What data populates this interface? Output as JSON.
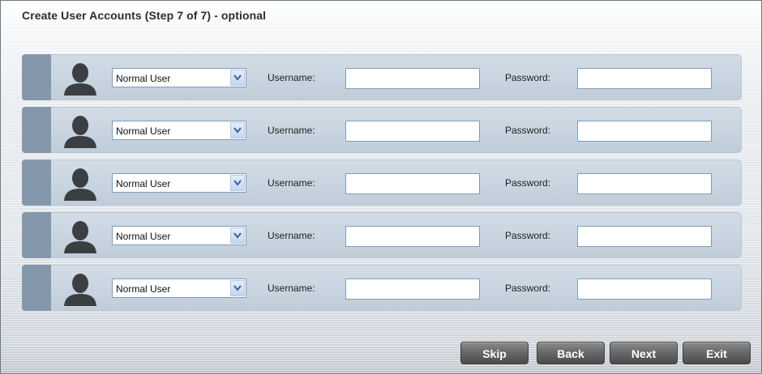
{
  "title": "Create User Accounts (Step 7 of 7) - optional",
  "rows": [
    {
      "role": "Normal User",
      "username_label": "Username:",
      "username": "",
      "password_label": "Password:",
      "password": ""
    },
    {
      "role": "Normal User",
      "username_label": "Username:",
      "username": "",
      "password_label": "Password:",
      "password": ""
    },
    {
      "role": "Normal User",
      "username_label": "Username:",
      "username": "",
      "password_label": "Password:",
      "password": ""
    },
    {
      "role": "Normal User",
      "username_label": "Username:",
      "username": "",
      "password_label": "Password:",
      "password": ""
    },
    {
      "role": "Normal User",
      "username_label": "Username:",
      "username": "",
      "password_label": "Password:",
      "password": ""
    }
  ],
  "buttons": {
    "skip": "Skip",
    "back": "Back",
    "next": "Next",
    "exit": "Exit"
  },
  "icons": {
    "avatar": "user-silhouette-icon",
    "dropdown": "chevron-down-icon"
  },
  "colors": {
    "row_background": "#c9d5e0",
    "row_handle": "#8598ab",
    "button": "#6a6a6a"
  }
}
